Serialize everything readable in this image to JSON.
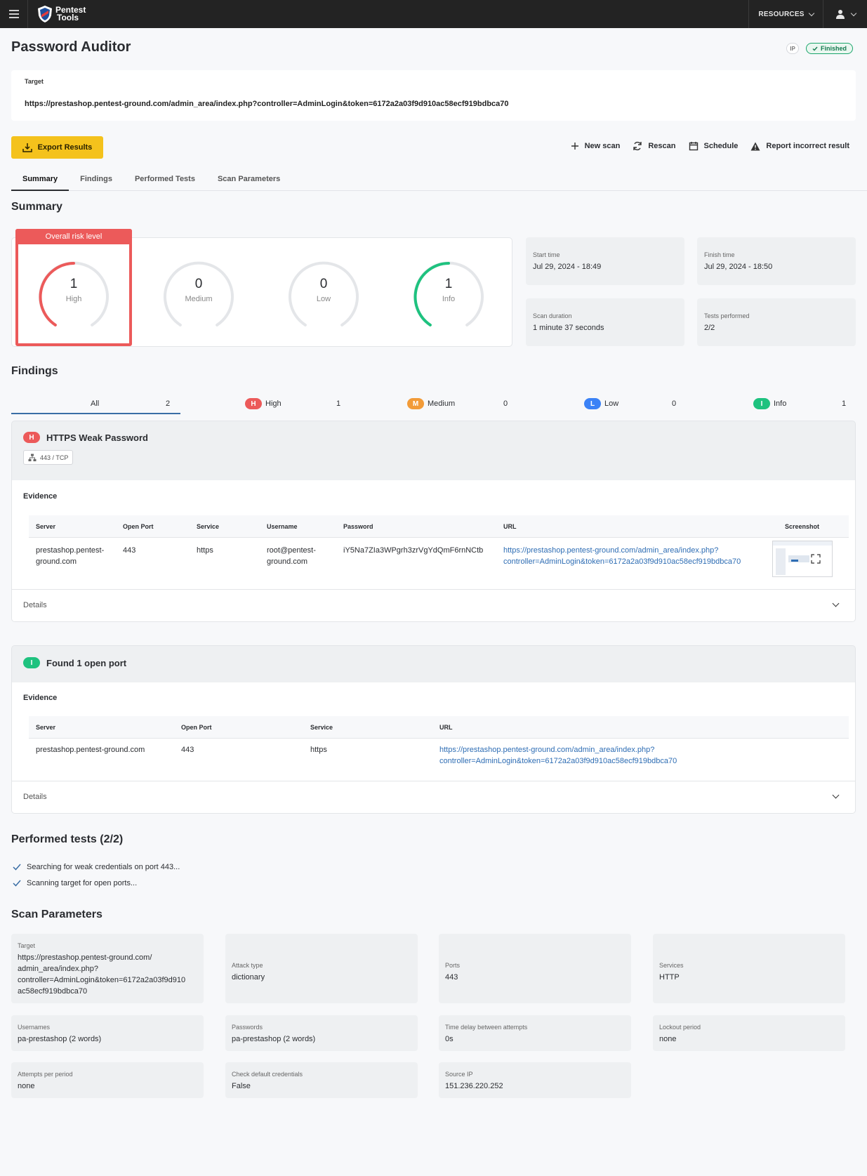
{
  "header": {
    "logo_line1": "Pentest",
    "logo_line2": "Tools",
    "resources_label": "RESOURCES"
  },
  "page": {
    "title": "Password Auditor",
    "ip_badge": "IP",
    "status": "Finished"
  },
  "target": {
    "label": "Target",
    "value": "https://prestashop.pentest-ground.com/admin_area/index.php?controller=AdminLogin&token=6172a2a03f9d910ac58ecf919bdbca70"
  },
  "toolbar": {
    "export_label": "Export Results",
    "new_scan": "New scan",
    "rescan": "Rescan",
    "schedule": "Schedule",
    "report": "Report incorrect result"
  },
  "tabs": [
    "Summary",
    "Findings",
    "Performed Tests",
    "Scan Parameters"
  ],
  "summary": {
    "title": "Summary",
    "risk_label": "Overall risk level",
    "gauges": [
      {
        "value": "1",
        "label": "High",
        "color": "#ec5a5a",
        "filled": true
      },
      {
        "value": "0",
        "label": "Medium",
        "color": "#f29b38",
        "filled": false
      },
      {
        "value": "0",
        "label": "Low",
        "color": "#3b82f6",
        "filled": false
      },
      {
        "value": "1",
        "label": "Info",
        "color": "#1ec27f",
        "filled": true
      }
    ],
    "stats": {
      "start_label": "Start time",
      "start_value": "Jul 29, 2024 - 18:49",
      "finish_label": "Finish time",
      "finish_value": "Jul 29, 2024 - 18:50",
      "duration_label": "Scan duration",
      "duration_value": "1 minute 37 seconds",
      "tests_label": "Tests performed",
      "tests_value": "2/2"
    }
  },
  "findings": {
    "title": "Findings",
    "filters": {
      "all_label": "All",
      "all_count": "2",
      "high_pill": "H",
      "high_label": "High",
      "high_count": "1",
      "medium_pill": "M",
      "medium_label": "Medium",
      "medium_count": "0",
      "low_pill": "L",
      "low_label": "Low",
      "low_count": "0",
      "info_pill": "I",
      "info_label": "Info",
      "info_count": "1"
    },
    "f1": {
      "pill": "H",
      "title": "HTTPS Weak Password",
      "port_chip": "443 / TCP",
      "evidence_label": "Evidence",
      "columns": [
        "Server",
        "Open Port",
        "Service",
        "Username",
        "Password",
        "URL",
        "Screenshot"
      ],
      "row": {
        "server_1": "prestashop.pentest-",
        "server_2": "ground.com",
        "port": "443",
        "service": "https",
        "username_1": "root@pentest-",
        "username_2": "ground.com",
        "password": "iY5Na7ZIa3WPgrh3zrVgYdQmF6rnNCtb",
        "url_1": "https://prestashop.pentest-ground.com/admin_area/index.php?",
        "url_2": "controller=AdminLogin&token=6172a2a03f9d910ac58ecf919bdbca70"
      },
      "details_label": "Details"
    },
    "f2": {
      "pill": "I",
      "title": "Found 1 open port",
      "evidence_label": "Evidence",
      "columns": [
        "Server",
        "Open Port",
        "Service",
        "URL"
      ],
      "row": {
        "server": "prestashop.pentest-ground.com",
        "port": "443",
        "service": "https",
        "url_1": "https://prestashop.pentest-ground.com/admin_area/index.php?",
        "url_2": "controller=AdminLogin&token=6172a2a03f9d910ac58ecf919bdbca70"
      },
      "details_label": "Details"
    }
  },
  "performed_tests": {
    "title": "Performed tests (2/2)",
    "items": [
      "Searching for weak credentials on port 443...",
      "Scanning target for open ports..."
    ]
  },
  "scan_parameters": {
    "title": "Scan Parameters",
    "target_label": "Target",
    "target_lines": [
      "https://prestashop.pentest-ground.com/",
      "admin_area/index.php?",
      "controller=AdminLogin&token=6172a2a03f9d910",
      "ac58ecf919bdbca70"
    ],
    "items": [
      {
        "label": "Attack type",
        "value": "dictionary"
      },
      {
        "label": "Ports",
        "value": "443"
      },
      {
        "label": "Services",
        "value": "HTTP"
      },
      {
        "label": "Usernames",
        "value": "pa-prestashop (2 words)"
      },
      {
        "label": "Passwords",
        "value": "pa-prestashop (2 words)"
      },
      {
        "label": "Time delay between attempts",
        "value": "0s"
      },
      {
        "label": "Lockout period",
        "value": "none"
      },
      {
        "label": "Attempts per period",
        "value": "none"
      },
      {
        "label": "Check default credentials",
        "value": "False"
      },
      {
        "label": "Source IP",
        "value": "151.236.220.252"
      }
    ]
  }
}
